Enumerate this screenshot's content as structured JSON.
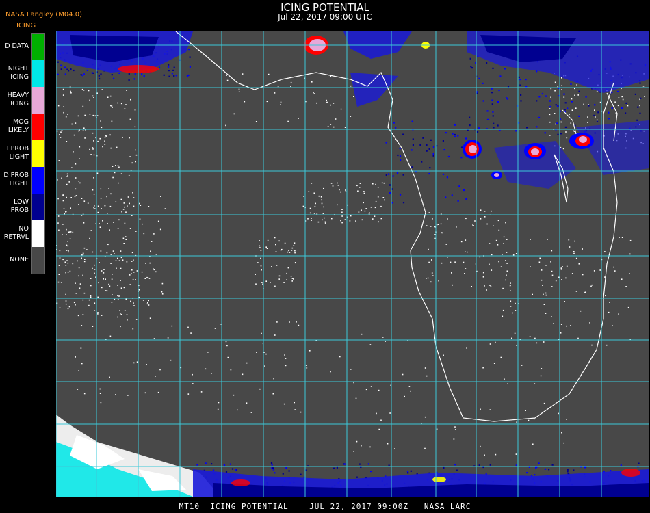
{
  "header": {
    "org": "NASA Langley (M04.0)",
    "product": "ICING",
    "title": "ICING POTENTIAL",
    "subtitle": "Jul 22, 2017 09:00 UTC"
  },
  "legend": [
    {
      "label": "D DATA",
      "color": "#00b000"
    },
    {
      "label": "NIGHT\nICING",
      "color": "#00e8e8"
    },
    {
      "label": "HEAVY\nICING",
      "color": "#e8a8d8"
    },
    {
      "label": "MOG\nLIKELY",
      "color": "#ff0000"
    },
    {
      "label": "I PROB\nLIGHT",
      "color": "#ffff00"
    },
    {
      "label": "D PROB\nLIGHT",
      "color": "#0000ff"
    },
    {
      "label": "LOW\nPROB",
      "color": "#000090"
    },
    {
      "label": "NO\nRETRVL",
      "color": "#ffffff"
    },
    {
      "label": "NONE",
      "color": "#484848"
    }
  ],
  "map": {
    "background": "#484848",
    "grid_color": "#3cc8d8",
    "coast_color": "#ffffff"
  },
  "footer": "MT10  ICING POTENTIAL    JUL 22, 2017 09:00Z   NASA LARC"
}
